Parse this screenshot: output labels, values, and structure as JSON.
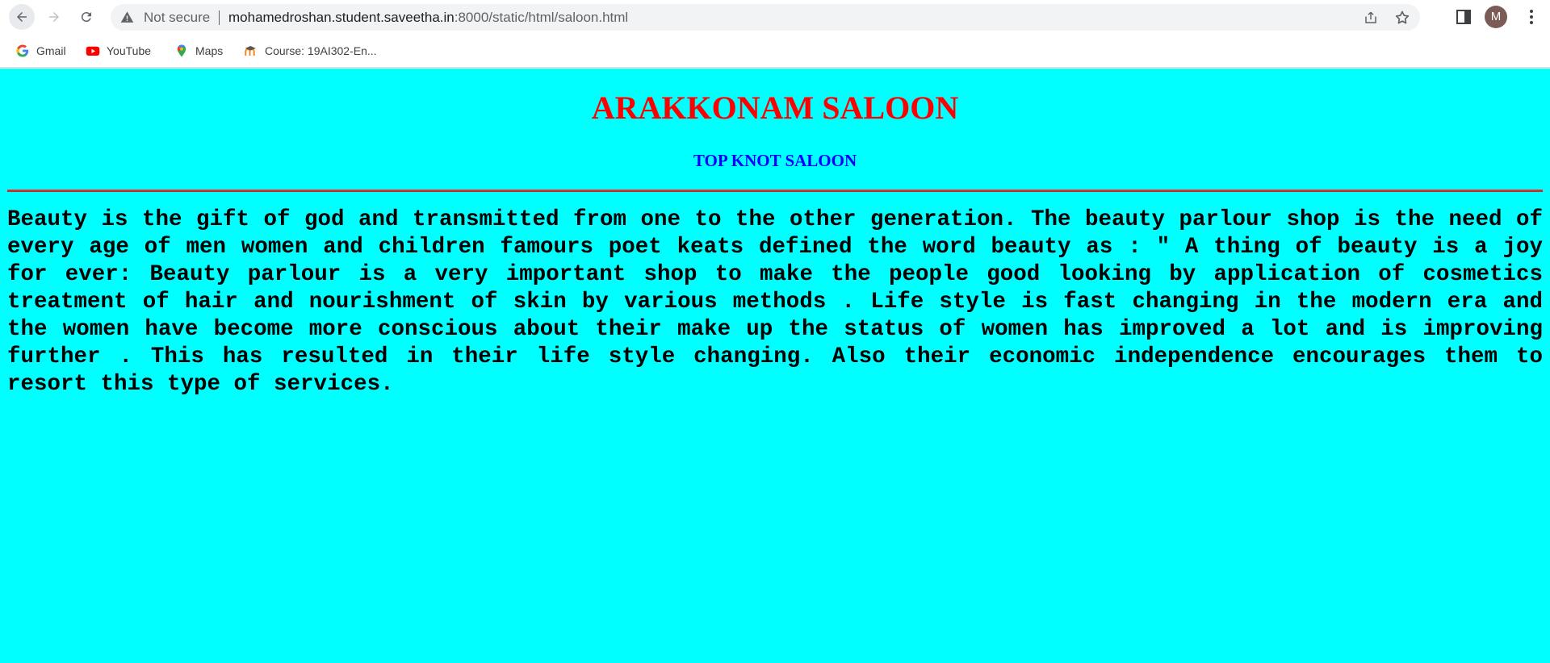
{
  "browser": {
    "security_status": "Not secure",
    "url_host": "mohamedroshan.student.saveetha.in",
    "url_path": ":8000/static/html/saloon.html",
    "profile_initial": "M",
    "bookmarks": [
      {
        "label": "Gmail",
        "icon": "gmail-icon"
      },
      {
        "label": "YouTube",
        "icon": "youtube-icon"
      },
      {
        "label": "Maps",
        "icon": "maps-icon"
      },
      {
        "label": "Course: 19AI302-En...",
        "icon": "moodle-icon"
      }
    ]
  },
  "page": {
    "background_color": "#00ffff",
    "title": "ARAKKONAM SALOON",
    "title_color": "#ff0000",
    "subtitle": "TOP KNOT SALOON",
    "subtitle_color": "#0000ff",
    "body": "Beauty is the gift of god and transmitted from one to the other generation. The beauty parlour shop is the need of every age of men women and children famours poet keats defined the word beauty as : \" A thing of beauty is a joy for ever: Beauty parlour is a very important shop to make the people good looking by application of cosmetics treatment of hair and nourishment of skin by various methods . Life style is fast changing in the modern era and the women have become more conscious about their make up the status of women has improved a lot and is improving further . This has resulted in their life style changing. Also their economic independence encourages them to resort this type of services."
  }
}
